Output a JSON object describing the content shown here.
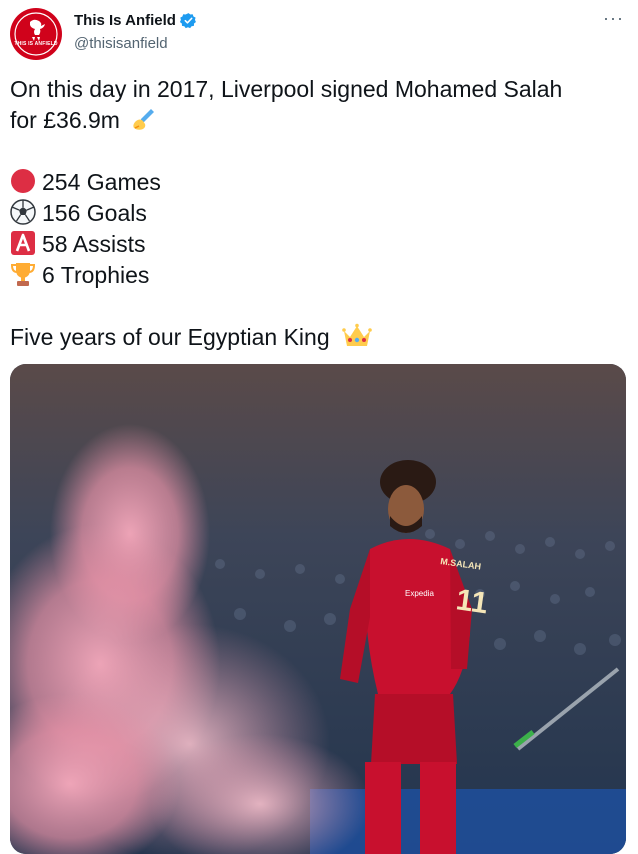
{
  "account": {
    "display_name": "This Is Anfield",
    "handle": "@thisisanfield",
    "avatar_text": "THIS IS ANFIELD",
    "more_label": "···"
  },
  "tweet": {
    "line1": "On this day in 2017, Liverpool signed Mohamed Salah",
    "line2": "for £36.9m",
    "stats": [
      {
        "icon": "red-circle-icon",
        "text": "254 Games"
      },
      {
        "icon": "soccer-ball-icon",
        "text": "156 Goals"
      },
      {
        "icon": "a-button-icon",
        "text": "58 Assists"
      },
      {
        "icon": "trophy-icon",
        "text": "6 Trophies"
      }
    ],
    "closing": "Five years of our Egyptian King"
  },
  "media": {
    "kit_sponsor": "Expedia",
    "shirt_name": "M.SALAH",
    "shirt_number": "11"
  },
  "colors": {
    "brand_red": "#d0021b",
    "verified_blue": "#1d9bf0",
    "kit_red": "#c8102e",
    "smoke_pink": "#f4a3b8"
  }
}
